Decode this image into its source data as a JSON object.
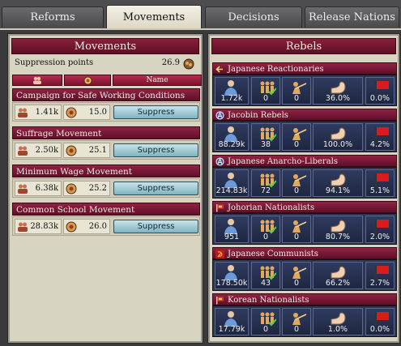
{
  "tabs": [
    "Reforms",
    "Movements",
    "Decisions",
    "Release Nations"
  ],
  "active_tab": 1,
  "movements": {
    "header": "Movements",
    "suppression_label": "Suppression points",
    "suppression_value": "26.9",
    "columns": {
      "name": "Name"
    },
    "items": [
      {
        "title": "Campaign for Safe Working Conditions",
        "supporters": "1.41k",
        "radicalism": "15.0",
        "button": "Suppress"
      },
      {
        "title": "Suffrage Movement",
        "supporters": "2.50k",
        "radicalism": "25.1",
        "button": "Suppress"
      },
      {
        "title": "Minimum Wage Movement",
        "supporters": "6.38k",
        "radicalism": "25.2",
        "button": "Suppress"
      },
      {
        "title": "Common School Movement",
        "supporters": "28.83k",
        "radicalism": "26.0",
        "button": "Suppress"
      }
    ]
  },
  "rebels": {
    "header": "Rebels",
    "items": [
      {
        "title": "Japanese Reactionaries",
        "icon": "arrow-left-icon",
        "size": "1.72k",
        "brigades": "0",
        "army_size": "0",
        "organization": "36.0%",
        "revolt_risk": "0.0%"
      },
      {
        "title": "Jacobin Rebels",
        "icon": "anarchy-icon",
        "size": "88.29k",
        "brigades": "38",
        "army_size": "0",
        "organization": "100.0%",
        "revolt_risk": "4.2%"
      },
      {
        "title": "Japanese Anarcho-Liberals",
        "icon": "anarchy-icon",
        "size": "214.83k",
        "brigades": "72",
        "army_size": "0",
        "organization": "94.1%",
        "revolt_risk": "5.1%"
      },
      {
        "title": "Johorian Nationalists",
        "icon": "nationalist-flag-icon",
        "size": "951",
        "brigades": "0",
        "army_size": "0",
        "organization": "80.7%",
        "revolt_risk": "2.0%"
      },
      {
        "title": "Japanese Communists",
        "icon": "hammer-sickle-icon",
        "size": "178.50k",
        "brigades": "43",
        "army_size": "0",
        "organization": "66.2%",
        "revolt_risk": "2.7%"
      },
      {
        "title": "Korean Nationalists",
        "icon": "nationalist-flag-icon",
        "size": "17.79k",
        "brigades": "0",
        "army_size": "0",
        "organization": "1.0%",
        "revolt_risk": "0.0%"
      }
    ]
  }
}
